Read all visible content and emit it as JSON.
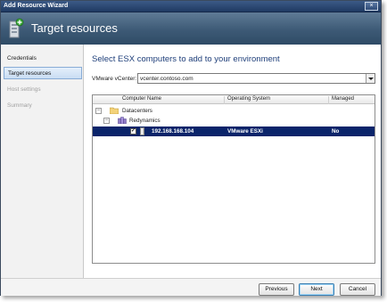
{
  "window": {
    "title": "Add Resource Wizard",
    "close_glyph": "×"
  },
  "banner": {
    "title": "Target resources",
    "icon": "wizard-computer-icon"
  },
  "sidebar": {
    "items": [
      {
        "label": "Credentials",
        "state": "normal"
      },
      {
        "label": "Target resources",
        "state": "active"
      },
      {
        "label": "Host settings",
        "state": "disabled"
      },
      {
        "label": "Summary",
        "state": "disabled"
      }
    ]
  },
  "main": {
    "heading": "Select ESX computers to add to your environment",
    "vcenter_label": "VMware vCenter:",
    "vcenter_value": "vcenter.contoso.com"
  },
  "grid": {
    "columns": [
      "Computer Name",
      "Operating System",
      "Managed"
    ],
    "tree": [
      {
        "label": "Datacenters",
        "expander": "−",
        "icon": "folder-icon"
      },
      {
        "label": "Redynamics",
        "expander": "−",
        "icon": "datacenter-icon"
      },
      {
        "computer_name": "192.168.168.104",
        "os": "VMware ESXi",
        "managed": "No",
        "checked": "✓",
        "icon": "server-icon"
      }
    ]
  },
  "footer": {
    "previous_label": "Previous",
    "next_label": "Next",
    "cancel_label": "Cancel"
  },
  "colors": {
    "title_bar": "#1f3a63",
    "banner": "#3d5a76",
    "heading": "#1f3f7a",
    "selection": "#0a246a",
    "sidebar_active": "#c9ddf3"
  }
}
